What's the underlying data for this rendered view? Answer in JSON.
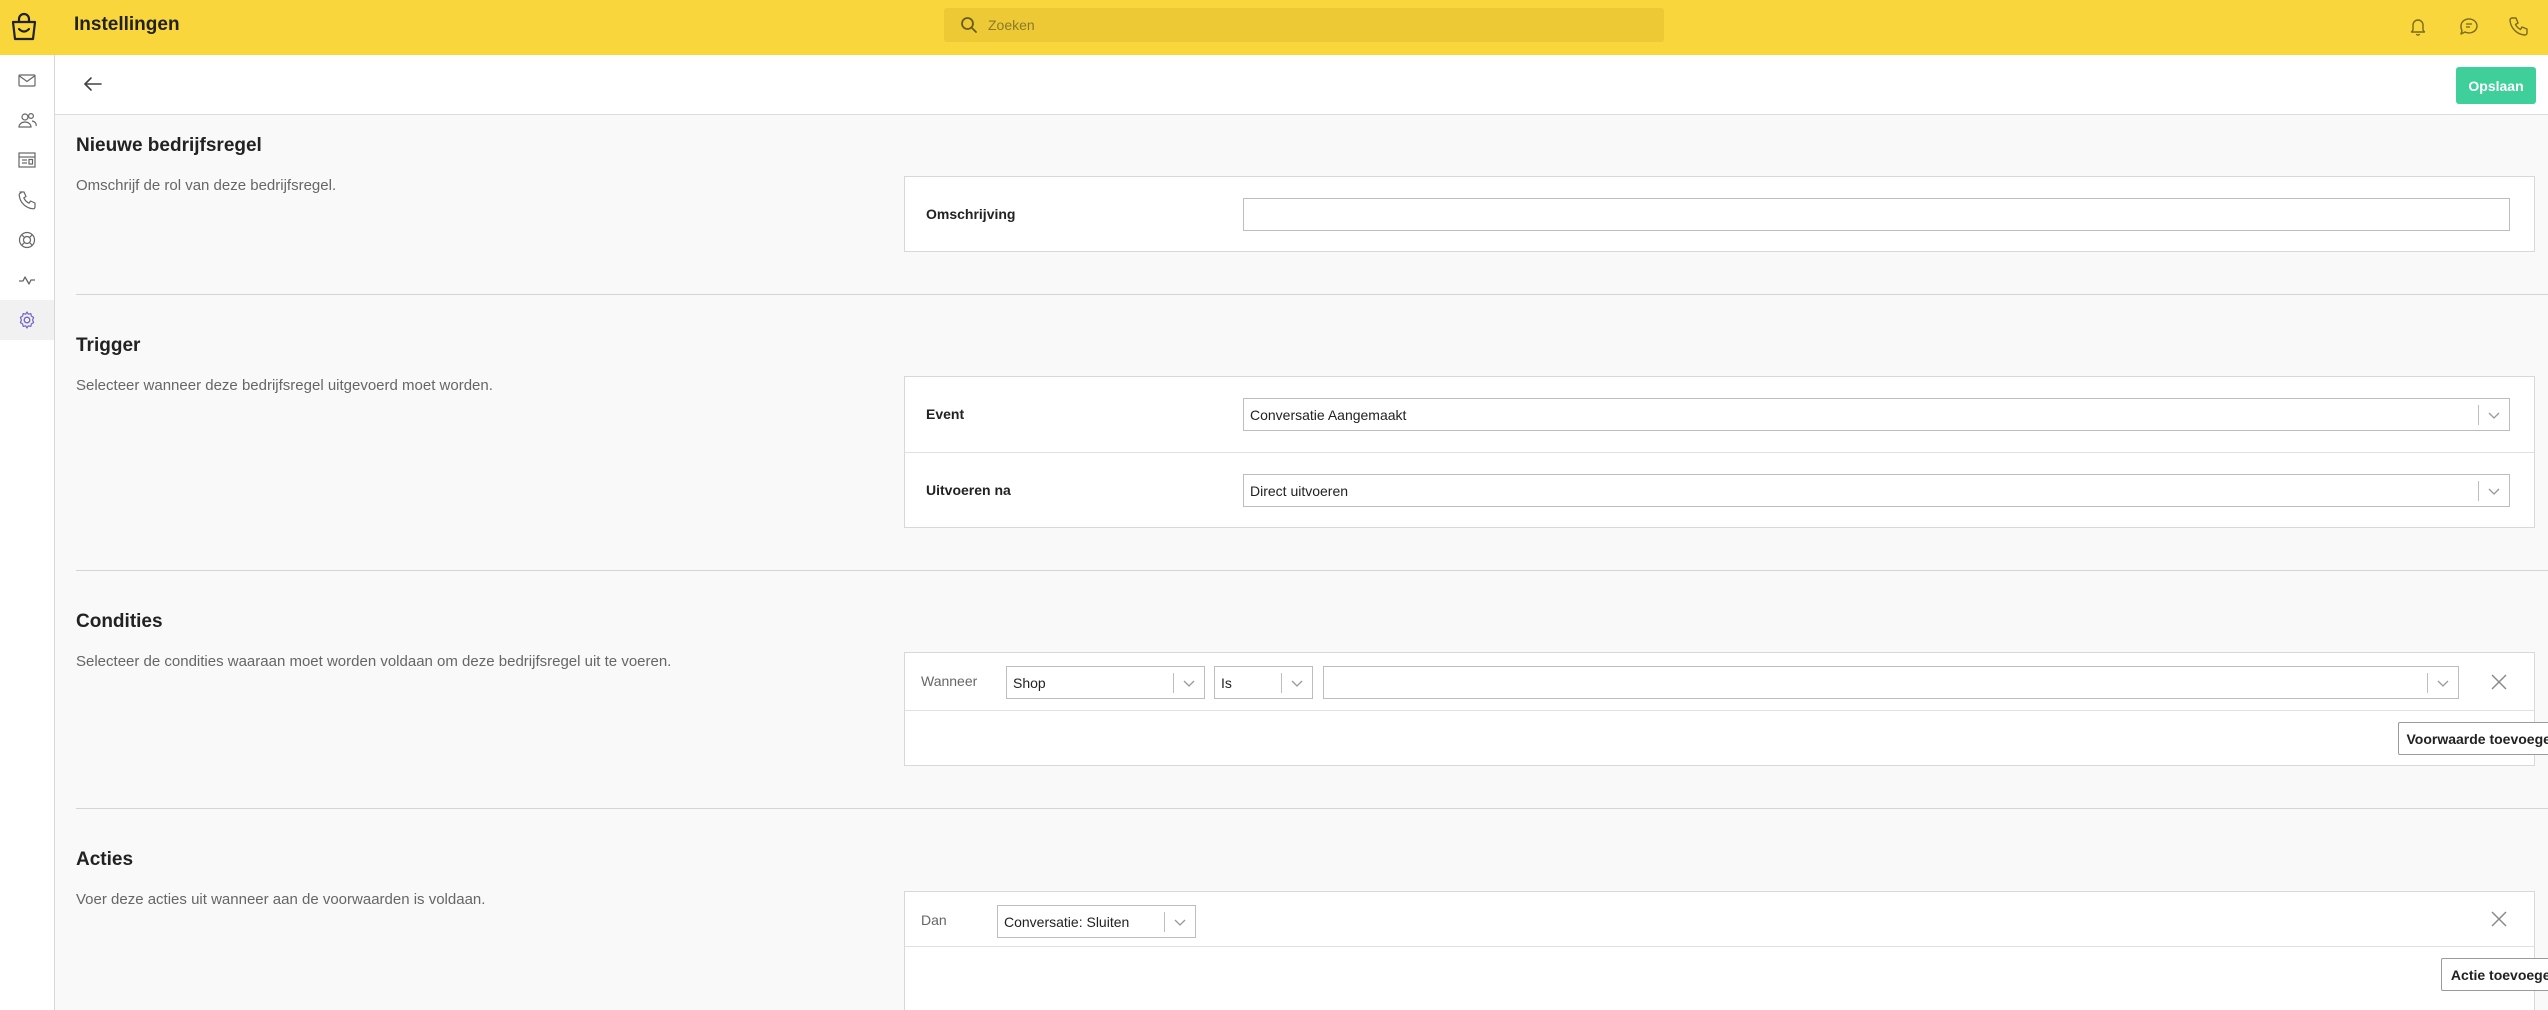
{
  "header": {
    "title": "Instellingen",
    "search_placeholder": "Zoeken",
    "icons": [
      "bell-icon",
      "chat-icon",
      "phone-icon"
    ],
    "accent_color": "#f9d63b"
  },
  "sidebar": {
    "items": [
      {
        "name": "inbox",
        "icon": "envelope-icon"
      },
      {
        "name": "contacts",
        "icon": "users-icon"
      },
      {
        "name": "reports",
        "icon": "report-icon"
      },
      {
        "name": "calls",
        "icon": "phone-icon"
      },
      {
        "name": "integrations",
        "icon": "support-icon"
      },
      {
        "name": "activity",
        "icon": "activity-icon"
      },
      {
        "name": "settings",
        "icon": "gear-icon",
        "active": true
      }
    ]
  },
  "toolbar": {
    "save_label": "Opslaan",
    "save_color": "#3ecf9a"
  },
  "sections": {
    "rule": {
      "title": "Nieuwe bedrijfsregel",
      "description": "Omschrijf de rol van deze bedrijfsregel.",
      "field_label": "Omschrijving",
      "field_value": ""
    },
    "trigger": {
      "title": "Trigger",
      "description": "Selecteer wanneer deze bedrijfsregel uitgevoerd moet worden.",
      "event_label": "Event",
      "event_value": "Conversatie Aangemaakt",
      "run_after_label": "Uitvoeren na",
      "run_after_value": "Direct uitvoeren"
    },
    "conditions": {
      "title": "Condities",
      "description": "Selecteer de condities waaraan moet worden voldaan om deze bedrijfsregel uit te voeren.",
      "when_label": "Wanneer",
      "field_value": "Shop",
      "operator_value": "Is",
      "value_value": "",
      "add_label": "Voorwaarde toevoegen"
    },
    "actions": {
      "title": "Acties",
      "description": "Voer deze acties uit wanneer aan de voorwaarden is voldaan.",
      "then_label": "Dan",
      "action_value": "Conversatie: Sluiten",
      "add_label": "Actie toevoegen"
    }
  }
}
